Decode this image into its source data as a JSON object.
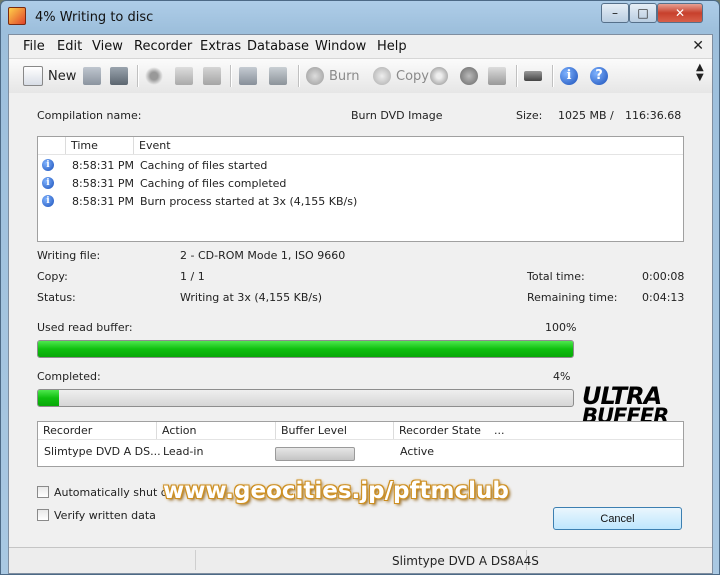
{
  "window": {
    "title": "4% Writing to disc"
  },
  "menu": [
    "File",
    "Edit",
    "View",
    "Recorder",
    "Extras",
    "Database",
    "Window",
    "Help"
  ],
  "toolbar": {
    "new_label": "New",
    "burn_label": "Burn",
    "copy_label": "Copy"
  },
  "compilation": {
    "name_label": "Compilation name:",
    "name_value": "Burn DVD Image",
    "size_label": "Size:",
    "size_mb": "1025 MB",
    "size_sep": "/",
    "size_time": "116:36.68"
  },
  "log": {
    "columns": [
      "Time",
      "Event"
    ],
    "rows": [
      {
        "time": "8:58:31 PM",
        "event": "Caching of files started"
      },
      {
        "time": "8:58:31 PM",
        "event": "Caching of files completed"
      },
      {
        "time": "8:58:31 PM",
        "event": "Burn process started at 3x (4,155 KB/s)"
      }
    ]
  },
  "details": {
    "writing_file_label": "Writing file:",
    "writing_file_value": "2 - CD-ROM Mode 1, ISO 9660",
    "copy_label": "Copy:",
    "copy_value": "1 / 1",
    "status_label": "Status:",
    "status_value": "Writing at 3x (4,155 KB/s)",
    "total_time_label": "Total time:",
    "total_time_value": "0:00:08",
    "remaining_label": "Remaining time:",
    "remaining_value": "0:04:13"
  },
  "buffer": {
    "label": "Used read buffer:",
    "percent_text": "100%",
    "fraction": 1.0
  },
  "completed": {
    "label": "Completed:",
    "percent_text": "4%",
    "fraction": 0.04
  },
  "logo": {
    "line1": "ULTRA",
    "line2": "BUFFER"
  },
  "recorder_table": {
    "columns": [
      "Recorder",
      "Action",
      "Buffer Level",
      "Recorder State",
      "..."
    ],
    "row": {
      "recorder": "Slimtype DVD A DS...",
      "action": "Lead-in",
      "state": "Active"
    }
  },
  "options": {
    "auto_shutdown": "Automatically shut dow",
    "verify": "Verify written data"
  },
  "cancel_label": "Cancel",
  "status_bar": {
    "device": "Slimtype DVD A DS8A4S"
  },
  "watermark": "www.geocities.jp/pftmclub",
  "colors": {
    "progress_green": "#0fbf0f",
    "title_bar": "#9dbfdc",
    "accent_button": "#3c7fb1"
  }
}
